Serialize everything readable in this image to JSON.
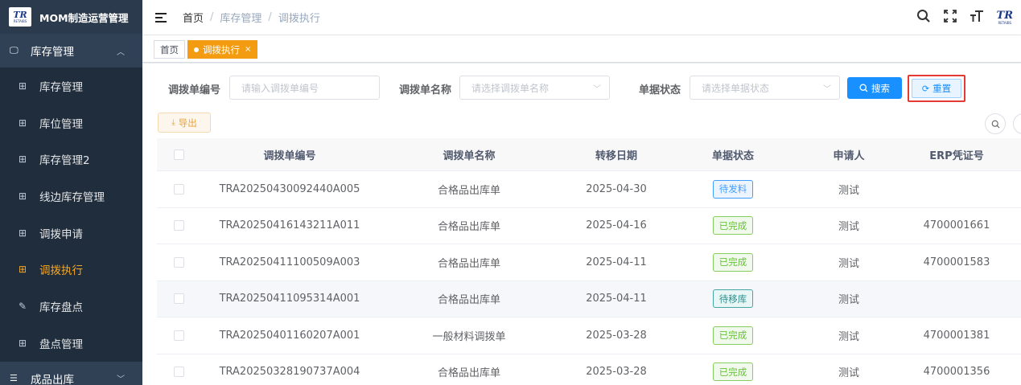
{
  "app": {
    "title": "MOM制造运营管理",
    "logo_text": "TR",
    "logo_sub": "RETAIBS"
  },
  "sidebar": {
    "group": {
      "label": "库存管理",
      "icon": "monitor-icon",
      "chevron": "chevron-up-icon"
    },
    "items": [
      {
        "label": "库存管理",
        "icon": "table-icon",
        "active": false
      },
      {
        "label": "库位管理",
        "icon": "table-icon",
        "active": false
      },
      {
        "label": "库存管理2",
        "icon": "table-icon",
        "active": false
      },
      {
        "label": "线边库存管理",
        "icon": "table-icon",
        "active": false
      },
      {
        "label": "调拨申请",
        "icon": "table-icon",
        "active": false
      },
      {
        "label": "调拨执行",
        "icon": "table-icon",
        "active": true
      },
      {
        "label": "库存盘点",
        "icon": "edit-icon",
        "active": false
      },
      {
        "label": "盘点管理",
        "icon": "table-icon",
        "active": false
      }
    ],
    "next_group": {
      "label": "成品出库",
      "icon": "list-icon"
    }
  },
  "header": {
    "breadcrumb": [
      "首页",
      "库存管理",
      "调拨执行"
    ],
    "separator": "/"
  },
  "tags": {
    "home": "首页",
    "current": "调拨执行",
    "close": "×"
  },
  "search": {
    "field1_label": "调拨单编号",
    "field1_placeholder": "请输入调拨单编号",
    "field2_label": "调拨单名称",
    "field2_placeholder": "请选择调拨单名称",
    "field3_label": "单据状态",
    "field3_placeholder": "请选择单据状态",
    "search_btn": "搜索",
    "reset_btn": "重置"
  },
  "toolbar": {
    "export_btn": "导出"
  },
  "table": {
    "columns": [
      "调拨单编号",
      "调拨单名称",
      "转移日期",
      "单据状态",
      "申请人",
      "ERP凭证号"
    ],
    "rows": [
      {
        "code": "TRA20250430092440A005",
        "name": "合格品出库单",
        "date": "2025-04-30",
        "status": "待发料",
        "status_type": "wait",
        "applicant": "测试",
        "erp": ""
      },
      {
        "code": "TRA20250416143211A011",
        "name": "合格品出库单",
        "date": "2025-04-16",
        "status": "已完成",
        "status_type": "done",
        "applicant": "测试",
        "erp": "4700001661"
      },
      {
        "code": "TRA20250411100509A003",
        "name": "合格品出库单",
        "date": "2025-04-11",
        "status": "已完成",
        "status_type": "done",
        "applicant": "测试",
        "erp": "4700001583"
      },
      {
        "code": "TRA20250411095314A001",
        "name": "合格品出库单",
        "date": "2025-04-11",
        "status": "待移库",
        "status_type": "move",
        "applicant": "测试",
        "erp": ""
      },
      {
        "code": "TRA20250401160207A001",
        "name": "一般材料调拨单",
        "date": "2025-03-28",
        "status": "已完成",
        "status_type": "done",
        "applicant": "测试",
        "erp": "4700001381"
      },
      {
        "code": "TRA20250328190737A004",
        "name": "合格品出库单",
        "date": "2025-03-28",
        "status": "已完成",
        "status_type": "done",
        "applicant": "测试",
        "erp": "4700001356"
      }
    ]
  },
  "colors": {
    "sidebar_bg": "#304156",
    "accent_orange": "#f39c12",
    "primary_blue": "#1890ff",
    "highlight_red": "#e53935"
  }
}
